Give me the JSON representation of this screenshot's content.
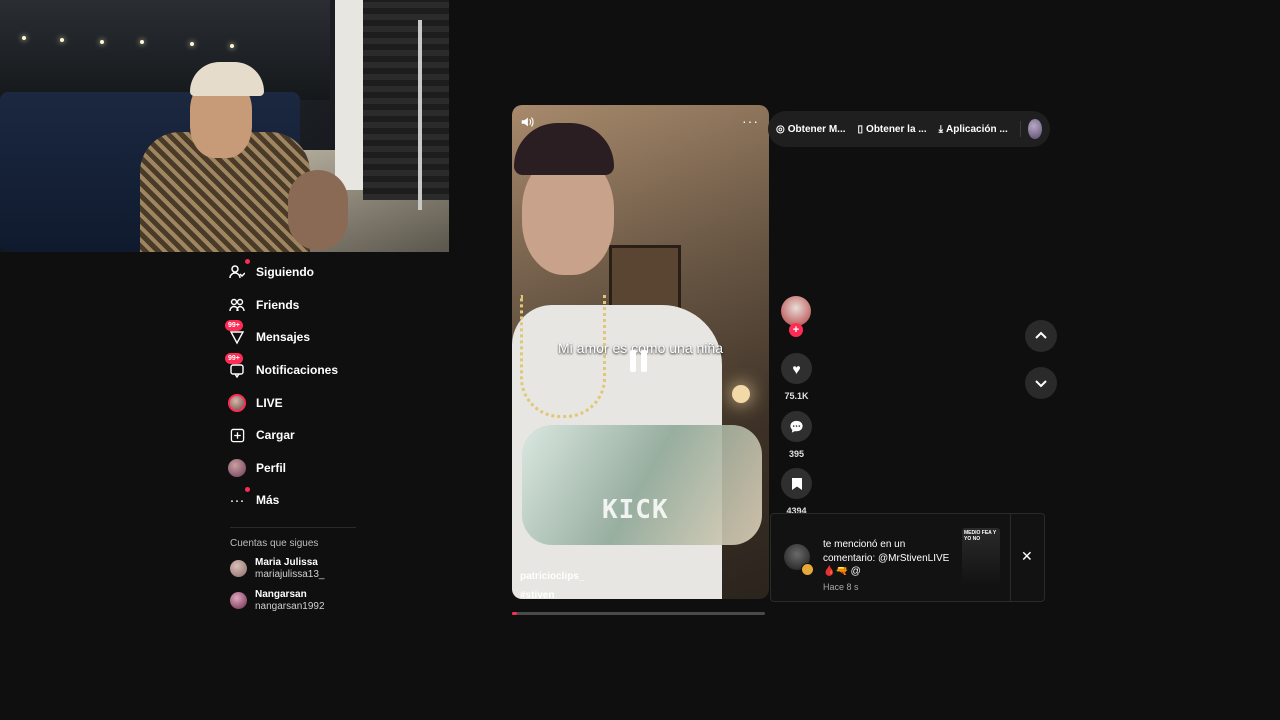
{
  "sidebar": {
    "items": [
      {
        "label": "Siguiendo",
        "icon": "user-follow-icon",
        "badge": ""
      },
      {
        "label": "Friends",
        "icon": "friends-icon",
        "badge": ""
      },
      {
        "label": "Mensajes",
        "icon": "messages-icon",
        "badge": "99+"
      },
      {
        "label": "Notificaciones",
        "icon": "notifications-icon",
        "badge": "99+"
      },
      {
        "label": "LIVE",
        "icon": "live-avatar-icon",
        "badge": ""
      },
      {
        "label": "Cargar",
        "icon": "upload-icon",
        "badge": ""
      },
      {
        "label": "Perfil",
        "icon": "profile-avatar-icon",
        "badge": ""
      },
      {
        "label": "Más",
        "icon": "more-icon",
        "badge": ""
      }
    ],
    "following_title": "Cuentas que sigues",
    "accounts": [
      {
        "name": "Maria Julissa",
        "handle": "mariajulissa13_"
      },
      {
        "name": "Nangarsan",
        "handle": "nangarsan1992"
      }
    ]
  },
  "top_pill": {
    "item1": "Obtener M...",
    "item2": "Obtener la ...",
    "item3": "Aplicación ..."
  },
  "video": {
    "caption": "Mi amor es como una niña",
    "watermark": "KICK",
    "author": "patricioclips_",
    "hashtag": "#stiven",
    "progress": 0.02
  },
  "actions": {
    "likes": "75.1K",
    "comments": "395",
    "saves": "4394"
  },
  "toast": {
    "message": "te mencionó en un comentario: @MrStivenLIVE 🩸🔫 @",
    "time": "Hace 8 s",
    "thumb_text": "MEDIO FEA Y YO NO"
  },
  "colors": {
    "accent": "#fe2c55",
    "background": "#0f0f0f"
  }
}
